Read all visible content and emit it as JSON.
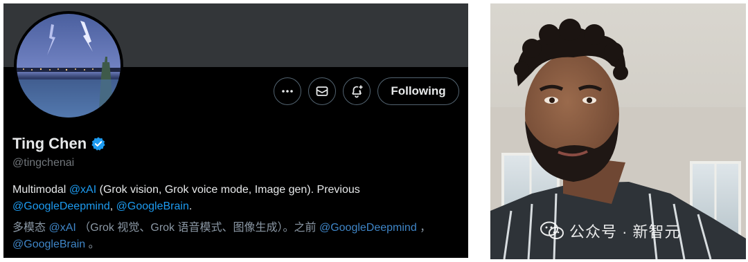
{
  "profile": {
    "display_name": "Ting Chen",
    "handle": "@tingchenai",
    "following_label": "Following",
    "bio": {
      "prefix": "Multimodal ",
      "mention_xai": "@xAI",
      "middle": " (Grok vision, Grok voice mode, Image gen). Previous",
      "mention_deepmind": "@GoogleDeepmind",
      "sep": ", ",
      "mention_brain": "@GoogleBrain",
      "suffix": "."
    },
    "bio_translation": {
      "prefix": "多模态 ",
      "mention_xai": "@xAI",
      "middle": " （Grok 视觉、Grok 语音模式、图像生成）。之前 ",
      "mention_deepmind": "@GoogleDeepmind",
      "sep": " ，",
      "mention_brain": "@GoogleBrain",
      "suffix": " 。"
    },
    "icons": [
      "more-icon",
      "mail-icon",
      "notify-bell-icon",
      "verified-badge-icon"
    ]
  },
  "watermark": {
    "text": "公众号 · 新智元",
    "icon": "wechat-icon"
  },
  "colors": {
    "card_bg": "#000000",
    "banner": "#333639",
    "mention": "#1d9bf0",
    "verified": "#1d9bf0"
  }
}
